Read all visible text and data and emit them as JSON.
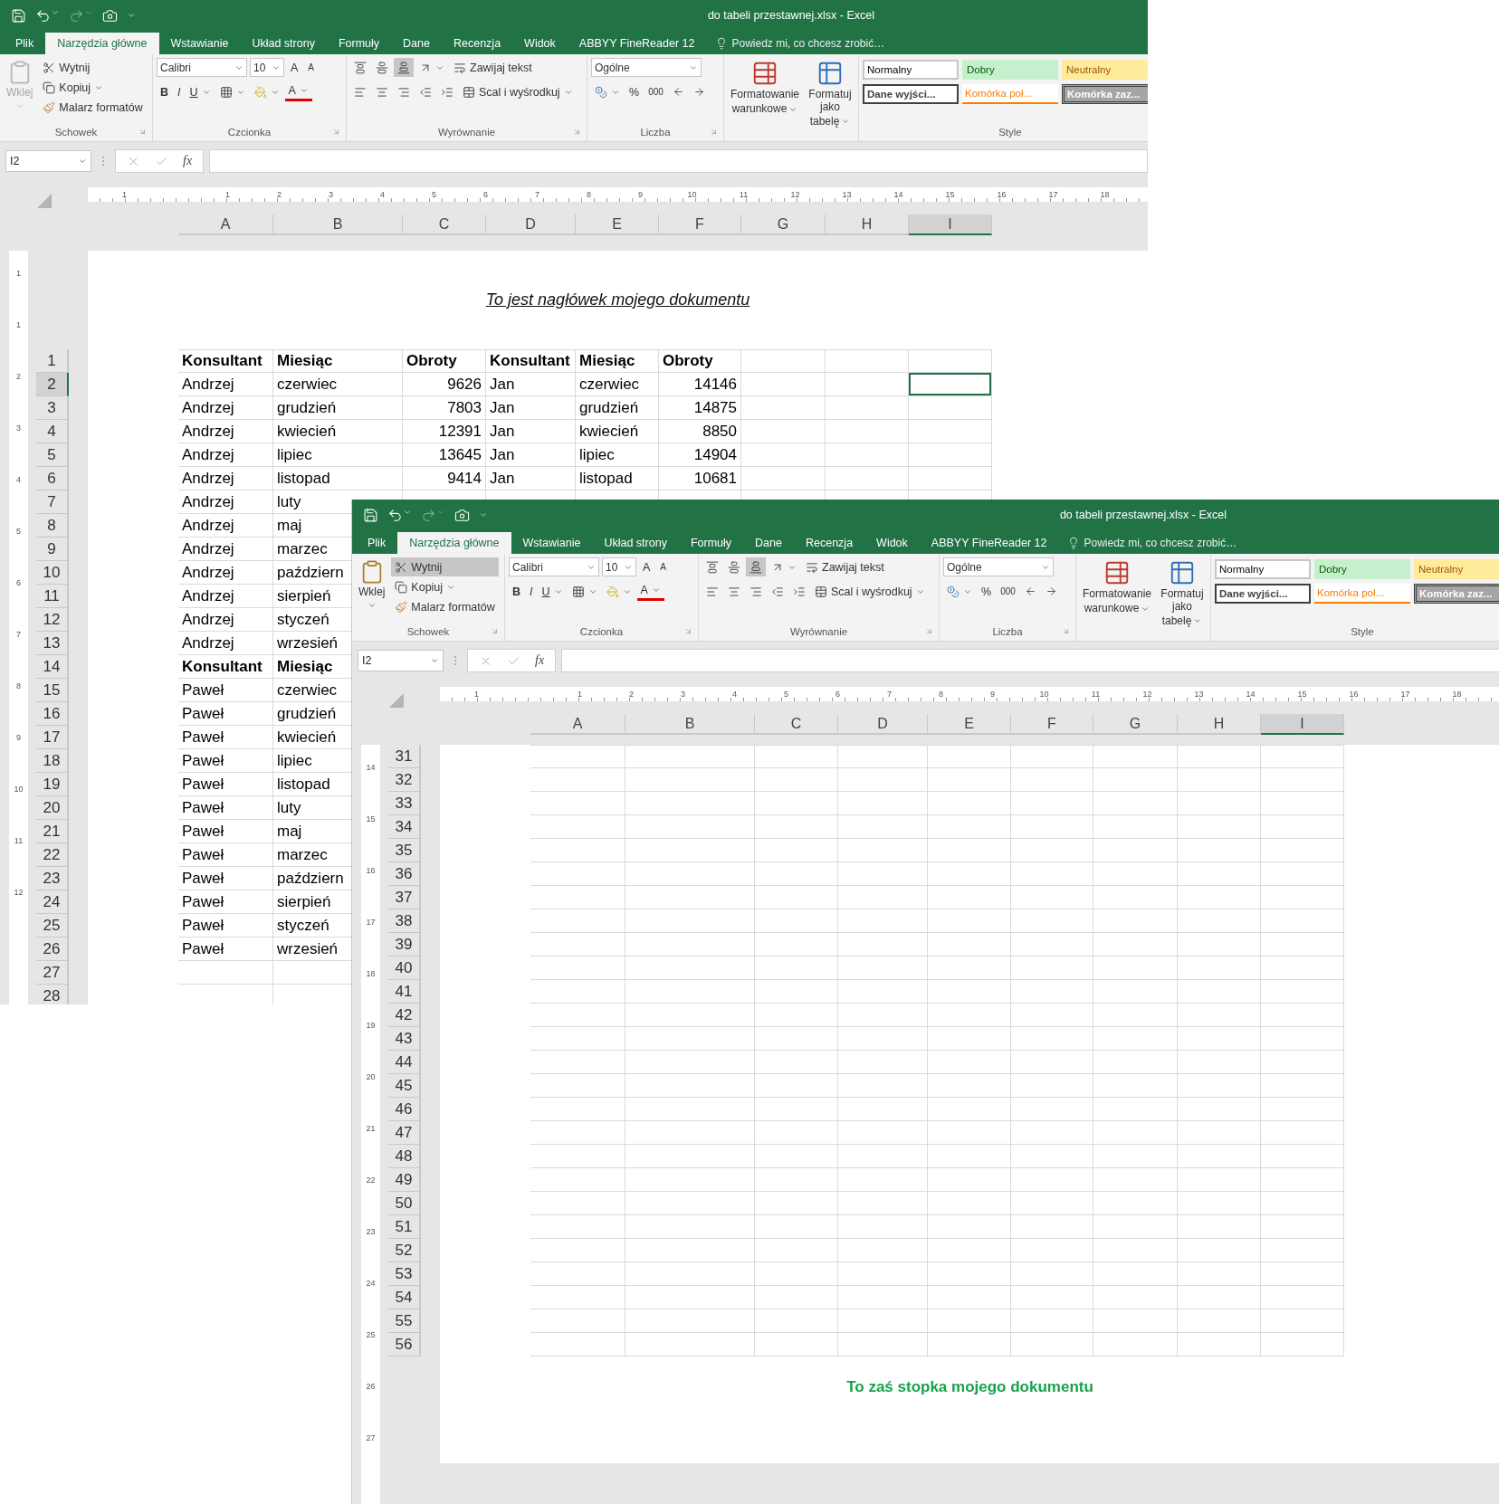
{
  "windows": [
    {
      "title": "do tabeli przestawnej.xlsx - Excel",
      "tabs": [
        {
          "label": "Plik",
          "selected": false
        },
        {
          "label": "Narzędzia główne",
          "selected": true
        },
        {
          "label": "Wstawianie",
          "selected": false
        },
        {
          "label": "Układ strony",
          "selected": false
        },
        {
          "label": "Formuły",
          "selected": false
        },
        {
          "label": "Dane",
          "selected": false
        },
        {
          "label": "Recenzja",
          "selected": false
        },
        {
          "label": "Widok",
          "selected": false
        },
        {
          "label": "ABBYY FineReader 12",
          "selected": false
        }
      ],
      "tell_me": "Powiedz mi, co chcesz zrobić…",
      "clipboard": {
        "label": "Schowek",
        "paste": "Wklej",
        "paste_enabled": false,
        "cut": "Wytnij",
        "cut_highlighted": false,
        "copy": "Kopiuj",
        "painter": "Malarz formatów"
      },
      "font": {
        "label": "Czcionka",
        "name": "Calibri",
        "size": "10",
        "grow": "A",
        "shrink": "A",
        "bold": "B",
        "italic": "I",
        "underline": "U",
        "font_color_letter": "A"
      },
      "alignment": {
        "label": "Wyrównanie",
        "wrap": "Zawijaj tekst",
        "merge": "Scal i wyśrodkuj",
        "vertical": [
          {
            "selected": false
          },
          {
            "selected": false
          },
          {
            "selected": true
          }
        ]
      },
      "number": {
        "label": "Liczba",
        "format": "Ogólne",
        "percent": "%",
        "thousands": "000"
      },
      "commands": [
        {
          "line1": "Formatowanie",
          "line2": "warunkowe",
          "kind": "conditional"
        },
        {
          "line1": "Formatuj jako",
          "line2": "tabelę",
          "kind": "table"
        }
      ],
      "styles": {
        "label": "Style",
        "items": [
          {
            "text": "Normalny",
            "kind": "normal"
          },
          {
            "text": "Dobry",
            "kind": "good"
          },
          {
            "text": "Neutralny",
            "kind": "neutral"
          },
          {
            "text": "Dane wyjści...",
            "kind": "output"
          },
          {
            "text": "Komórka poł...",
            "kind": "linked"
          },
          {
            "text": "Komórka zaz...",
            "kind": "check"
          }
        ]
      },
      "name_box": "I2",
      "fx": "fx",
      "h_ruler": [
        "1",
        "1",
        "2",
        "3",
        "4",
        "5",
        "6",
        "7",
        "8",
        "9",
        "10",
        "11",
        "12",
        "13",
        "14",
        "15",
        "16",
        "17",
        "18"
      ],
      "columns": [
        {
          "label": "A",
          "selected": false,
          "numeric": false
        },
        {
          "label": "B",
          "selected": false,
          "numeric": false
        },
        {
          "label": "C",
          "selected": false,
          "numeric": true
        },
        {
          "label": "D",
          "selected": false,
          "numeric": false
        },
        {
          "label": "E",
          "selected": false,
          "numeric": false
        },
        {
          "label": "F",
          "selected": false,
          "numeric": true
        },
        {
          "label": "G",
          "selected": false
        },
        {
          "label": "H",
          "selected": false
        },
        {
          "label": "I",
          "selected": true
        }
      ],
      "v_ruler": [
        "1",
        "1",
        "2",
        "3",
        "4",
        "5",
        "6",
        "7",
        "8",
        "9",
        "10",
        "11",
        "12"
      ],
      "header_text": "To jest nagłówek mojego dokumentu",
      "rows": [
        {
          "number": "1",
          "selected": false,
          "kind": "header",
          "cells": [
            "Konsultant",
            "Miesiąc",
            "Obroty",
            "Konsultant",
            "Miesiąc",
            "Obroty"
          ]
        },
        {
          "number": "2",
          "selected": true,
          "kind": "data",
          "cells": [
            "Andrzej",
            "czerwiec",
            "9626",
            "Jan",
            "czerwiec",
            "14146"
          ]
        },
        {
          "number": "3",
          "selected": false,
          "kind": "data",
          "cells": [
            "Andrzej",
            "grudzień",
            "7803",
            "Jan",
            "grudzień",
            "14875"
          ]
        },
        {
          "number": "4",
          "selected": false,
          "kind": "data",
          "cells": [
            "Andrzej",
            "kwiecień",
            "12391",
            "Jan",
            "kwiecień",
            "8850"
          ]
        },
        {
          "number": "5",
          "selected": false,
          "kind": "data",
          "cells": [
            "Andrzej",
            "lipiec",
            "13645",
            "Jan",
            "lipiec",
            "14904"
          ]
        },
        {
          "number": "6",
          "selected": false,
          "kind": "data",
          "cells": [
            "Andrzej",
            "listopad",
            "9414",
            "Jan",
            "listopad",
            "10681"
          ]
        },
        {
          "number": "7",
          "selected": false,
          "kind": "data",
          "cells": [
            "Andrzej",
            "luty"
          ]
        },
        {
          "number": "8",
          "selected": false,
          "kind": "data",
          "cells": [
            "Andrzej",
            "maj"
          ]
        },
        {
          "number": "9",
          "selected": false,
          "kind": "data",
          "cells": [
            "Andrzej",
            "marzec"
          ]
        },
        {
          "number": "10",
          "selected": false,
          "kind": "data",
          "cells": [
            "Andrzej",
            "październ"
          ]
        },
        {
          "number": "11",
          "selected": false,
          "kind": "data",
          "cells": [
            "Andrzej",
            "sierpień"
          ]
        },
        {
          "number": "12",
          "selected": false,
          "kind": "data",
          "cells": [
            "Andrzej",
            "styczeń"
          ]
        },
        {
          "number": "13",
          "selected": false,
          "kind": "data",
          "cells": [
            "Andrzej",
            "wrzesień"
          ]
        },
        {
          "number": "14",
          "selected": false,
          "kind": "header",
          "cells": [
            "Konsultant",
            "Miesiąc"
          ]
        },
        {
          "number": "15",
          "selected": false,
          "kind": "data",
          "cells": [
            "Paweł",
            "czerwiec"
          ]
        },
        {
          "number": "16",
          "selected": false,
          "kind": "data",
          "cells": [
            "Paweł",
            "grudzień"
          ]
        },
        {
          "number": "17",
          "selected": false,
          "kind": "data",
          "cells": [
            "Paweł",
            "kwiecień"
          ]
        },
        {
          "number": "18",
          "selected": false,
          "kind": "data",
          "cells": [
            "Paweł",
            "lipiec"
          ]
        },
        {
          "number": "19",
          "selected": false,
          "kind": "data",
          "cells": [
            "Paweł",
            "listopad"
          ]
        },
        {
          "number": "20",
          "selected": false,
          "kind": "data",
          "cells": [
            "Paweł",
            "luty"
          ]
        },
        {
          "number": "21",
          "selected": false,
          "kind": "data",
          "cells": [
            "Paweł",
            "maj"
          ]
        },
        {
          "number": "22",
          "selected": false,
          "kind": "data",
          "cells": [
            "Paweł",
            "marzec"
          ]
        },
        {
          "number": "23",
          "selected": false,
          "kind": "data",
          "cells": [
            "Paweł",
            "październ"
          ]
        },
        {
          "number": "24",
          "selected": false,
          "kind": "data",
          "cells": [
            "Paweł",
            "sierpień"
          ]
        },
        {
          "number": "25",
          "selected": false,
          "kind": "data",
          "cells": [
            "Paweł",
            "styczeń"
          ]
        },
        {
          "number": "26",
          "selected": false,
          "kind": "data",
          "cells": [
            "Paweł",
            "wrzesień"
          ]
        },
        {
          "number": "27",
          "selected": false,
          "kind": "data"
        },
        {
          "number": "28",
          "selected": false,
          "kind": "data"
        }
      ]
    },
    {
      "title": "do tabeli przestawnej.xlsx - Excel",
      "tabs": [
        {
          "label": "Plik",
          "selected": false
        },
        {
          "label": "Narzędzia główne",
          "selected": true
        },
        {
          "label": "Wstawianie",
          "selected": false
        },
        {
          "label": "Układ strony",
          "selected": false
        },
        {
          "label": "Formuły",
          "selected": false
        },
        {
          "label": "Dane",
          "selected": false
        },
        {
          "label": "Recenzja",
          "selected": false
        },
        {
          "label": "Widok",
          "selected": false
        },
        {
          "label": "ABBYY FineReader 12",
          "selected": false
        }
      ],
      "tell_me": "Powiedz mi, co chcesz zrobić…",
      "clipboard": {
        "label": "Schowek",
        "paste": "Wklej",
        "paste_enabled": true,
        "cut": "Wytnij",
        "cut_highlighted": true,
        "copy": "Kopiuj",
        "painter": "Malarz formatów"
      },
      "font": {
        "label": "Czcionka",
        "name": "Calibri",
        "size": "10",
        "grow": "A",
        "shrink": "A",
        "bold": "B",
        "italic": "I",
        "underline": "U",
        "font_color_letter": "A"
      },
      "alignment": {
        "label": "Wyrównanie",
        "wrap": "Zawijaj tekst",
        "merge": "Scal i wyśrodkuj",
        "vertical": [
          {
            "selected": false
          },
          {
            "selected": false
          },
          {
            "selected": true
          }
        ]
      },
      "number": {
        "label": "Liczba",
        "format": "Ogólne",
        "percent": "%",
        "thousands": "000"
      },
      "commands": [
        {
          "line1": "Formatowanie",
          "line2": "warunkowe",
          "kind": "conditional"
        },
        {
          "line1": "Formatuj jako",
          "line2": "tabelę",
          "kind": "table"
        }
      ],
      "styles": {
        "label": "Style",
        "items": [
          {
            "text": "Normalny",
            "kind": "normal"
          },
          {
            "text": "Dobry",
            "kind": "good"
          },
          {
            "text": "Neutralny",
            "kind": "neutral"
          },
          {
            "text": "Dane wyjści...",
            "kind": "output"
          },
          {
            "text": "Komórka poł...",
            "kind": "linked"
          },
          {
            "text": "Komórka zaz...",
            "kind": "check"
          }
        ]
      },
      "name_box": "I2",
      "fx": "fx",
      "h_ruler": [
        "1",
        "1",
        "2",
        "3",
        "4",
        "5",
        "6",
        "7",
        "8",
        "9",
        "10",
        "11",
        "12",
        "13",
        "14",
        "15",
        "16",
        "17",
        "18"
      ],
      "columns": [
        {
          "label": "A",
          "selected": false
        },
        {
          "label": "B",
          "selected": false
        },
        {
          "label": "C",
          "selected": false
        },
        {
          "label": "D",
          "selected": false
        },
        {
          "label": "E",
          "selected": false
        },
        {
          "label": "F",
          "selected": false
        },
        {
          "label": "G",
          "selected": false
        },
        {
          "label": "H",
          "selected": false
        },
        {
          "label": "I",
          "selected": true
        }
      ],
      "v_ruler": [
        "14",
        "15",
        "16",
        "17",
        "18",
        "19",
        "20",
        "21",
        "22",
        "23",
        "24",
        "25",
        "26",
        "27"
      ],
      "rows": [
        {
          "number": "31",
          "selected": false
        },
        {
          "number": "32",
          "selected": false
        },
        {
          "number": "33",
          "selected": false
        },
        {
          "number": "34",
          "selected": false
        },
        {
          "number": "35",
          "selected": false
        },
        {
          "number": "36",
          "selected": false
        },
        {
          "number": "37",
          "selected": false
        },
        {
          "number": "38",
          "selected": false
        },
        {
          "number": "39",
          "selected": false
        },
        {
          "number": "40",
          "selected": false
        },
        {
          "number": "41",
          "selected": false
        },
        {
          "number": "42",
          "selected": false
        },
        {
          "number": "43",
          "selected": false
        },
        {
          "number": "44",
          "selected": false
        },
        {
          "number": "45",
          "selected": false
        },
        {
          "number": "46",
          "selected": false
        },
        {
          "number": "47",
          "selected": false
        },
        {
          "number": "48",
          "selected": false
        },
        {
          "number": "49",
          "selected": false
        },
        {
          "number": "50",
          "selected": false
        },
        {
          "number": "51",
          "selected": false
        },
        {
          "number": "52",
          "selected": false
        },
        {
          "number": "53",
          "selected": false
        },
        {
          "number": "54",
          "selected": false
        },
        {
          "number": "55",
          "selected": false
        },
        {
          "number": "56",
          "selected": false
        }
      ],
      "footer_text": "To zaś stopka mojego dokumentu"
    }
  ]
}
